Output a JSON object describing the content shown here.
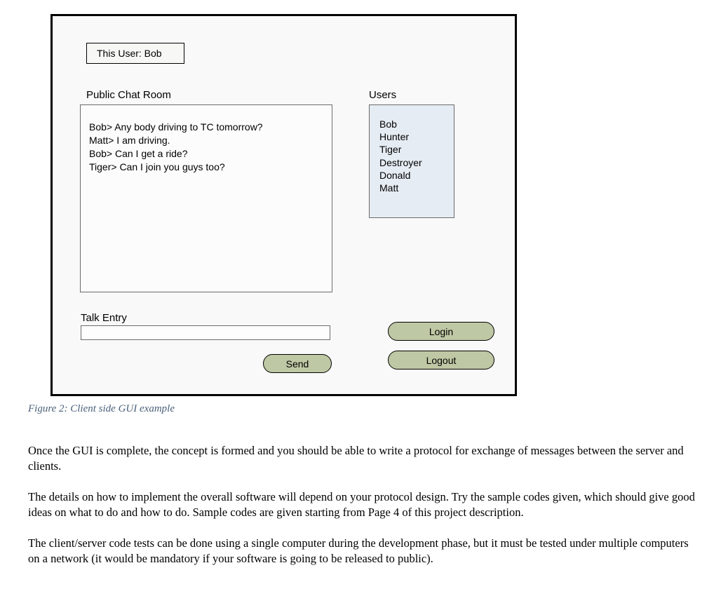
{
  "gui": {
    "this_user": "This User: Bob",
    "chat_label": "Public Chat Room",
    "users_label": "Users",
    "talk_label": "Talk Entry",
    "talk_value": "",
    "chat_lines": [
      "Bob> Any body driving to TC tomorrow?",
      "Matt> I am driving.",
      "Bob> Can I get a ride?",
      "Tiger> Can I join you guys too?"
    ],
    "users": [
      "Bob",
      "Hunter",
      "Tiger",
      "Destroyer",
      "Donald",
      "Matt"
    ],
    "buttons": {
      "send": "Send",
      "login": "Login",
      "logout": "Logout"
    }
  },
  "caption": "Figure 2: Client side GUI example",
  "paragraphs": [
    "Once the GUI is complete, the concept is formed and you should be able to write a protocol for exchange of messages between the server and clients.",
    "The details on how to implement the overall software will depend on your protocol design. Try the sample codes given, which should give good ideas on what to do and how to do. Sample codes are given starting from Page 4 of this project description.",
    "The client/server code tests can be done using a single computer during the development phase, but it must be tested under multiple computers on a network (it would be mandatory if your software is going to be released to public)."
  ]
}
